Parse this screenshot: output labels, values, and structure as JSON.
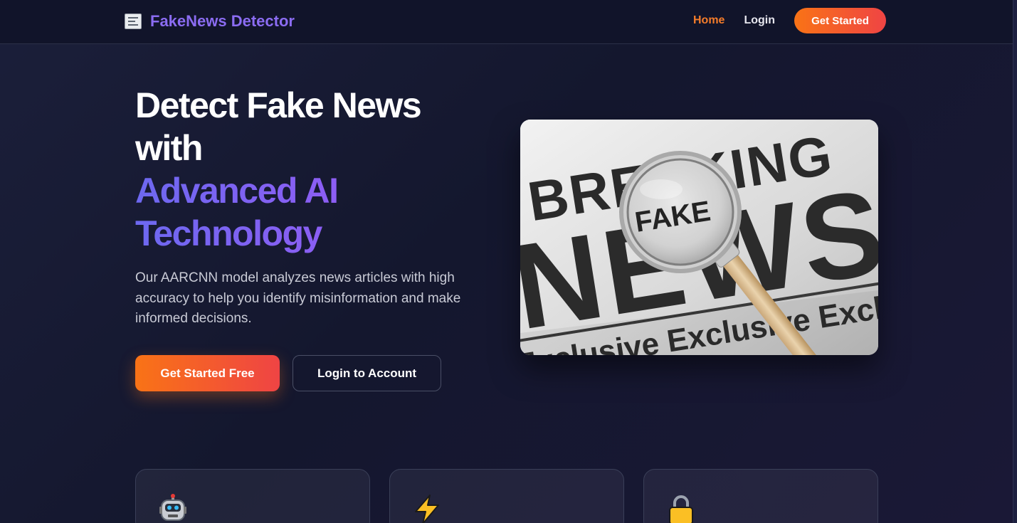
{
  "nav": {
    "brand_icon": "newspaper-icon",
    "brand": "FakeNews Detector",
    "links": [
      "Home",
      "Login"
    ],
    "cta": "Get Started"
  },
  "hero": {
    "title_line1": "Detect Fake News",
    "title_line2": "with",
    "title_accent1": "Advanced AI",
    "title_accent2": "Technology",
    "description": "Our AARCNN model analyzes news articles with high accuracy to help you identify misinformation and make informed decisions.",
    "primary_button": "Get Started Free",
    "secondary_button": "Login to Account"
  },
  "hero_image": {
    "headline_top": "BREAKING",
    "headline_main": "NEWS",
    "lens_text": "FAKE",
    "banner_text": "Exclusive Exclusive Exclusive Excl"
  },
  "features": [
    {
      "icon": "robot-icon"
    },
    {
      "icon": "lightning-icon"
    },
    {
      "icon": "lock-icon"
    }
  ],
  "colors": {
    "brand": "#8b6cf2",
    "accent_orange": "#f97316",
    "accent_red": "#ef4444",
    "accent_purple": "#a855f7",
    "background": "#14172e"
  }
}
